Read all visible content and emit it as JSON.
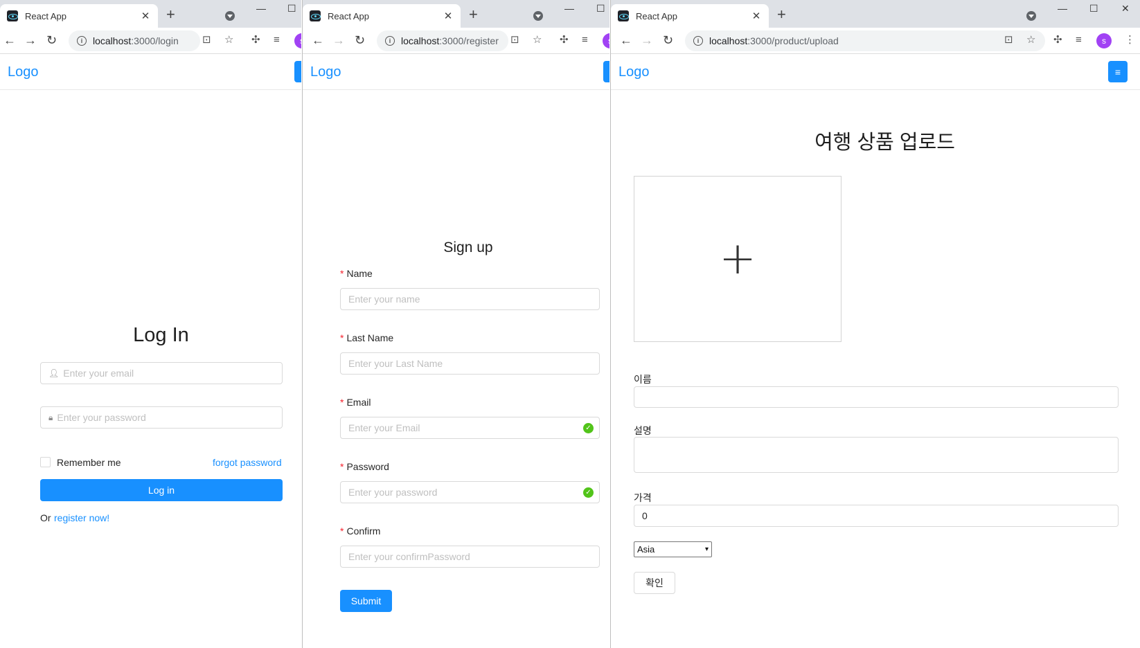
{
  "browser": {
    "tab_title": "React App",
    "tab_close": "✕",
    "new_tab": "+",
    "profile_initial": "s"
  },
  "windows": [
    {
      "url_host": "localhost",
      "url_path": ":3000/login"
    },
    {
      "url_host": "localhost",
      "url_path": ":3000/register"
    },
    {
      "url_host": "localhost",
      "url_path": ":3000/product/upload"
    }
  ],
  "app": {
    "logo": "Logo"
  },
  "login": {
    "title": "Log In",
    "email_placeholder": "Enter your email",
    "password_placeholder": "Enter your password",
    "remember_label": "Remember me",
    "forgot_link": "forgot password",
    "submit_label": "Log in",
    "or_text": "Or",
    "register_link": "register now!"
  },
  "register": {
    "title": "Sign up",
    "fields": [
      {
        "label": "Name",
        "placeholder": "Enter your name",
        "valid": false
      },
      {
        "label": "Last Name",
        "placeholder": "Enter your Last Name",
        "valid": false
      },
      {
        "label": "Email",
        "placeholder": "Enter your Email",
        "valid": true
      },
      {
        "label": "Password",
        "placeholder": "Enter your password",
        "valid": true
      },
      {
        "label": "Confirm",
        "placeholder": "Enter your confirmPassword",
        "valid": false
      }
    ],
    "submit_label": "Submit"
  },
  "upload": {
    "title": "여행 상품 업로드",
    "dropzone_plus": "+",
    "name_label": "이름",
    "name_value": "",
    "description_label": "설명",
    "description_value": "",
    "price_label": "가격",
    "price_value": "0",
    "continent_selected": "Asia",
    "confirm_label": "확인"
  },
  "colors": {
    "primary": "#1890ff",
    "success": "#52c41a",
    "required": "#f5222d",
    "tabstrip": "#dee1e6"
  }
}
